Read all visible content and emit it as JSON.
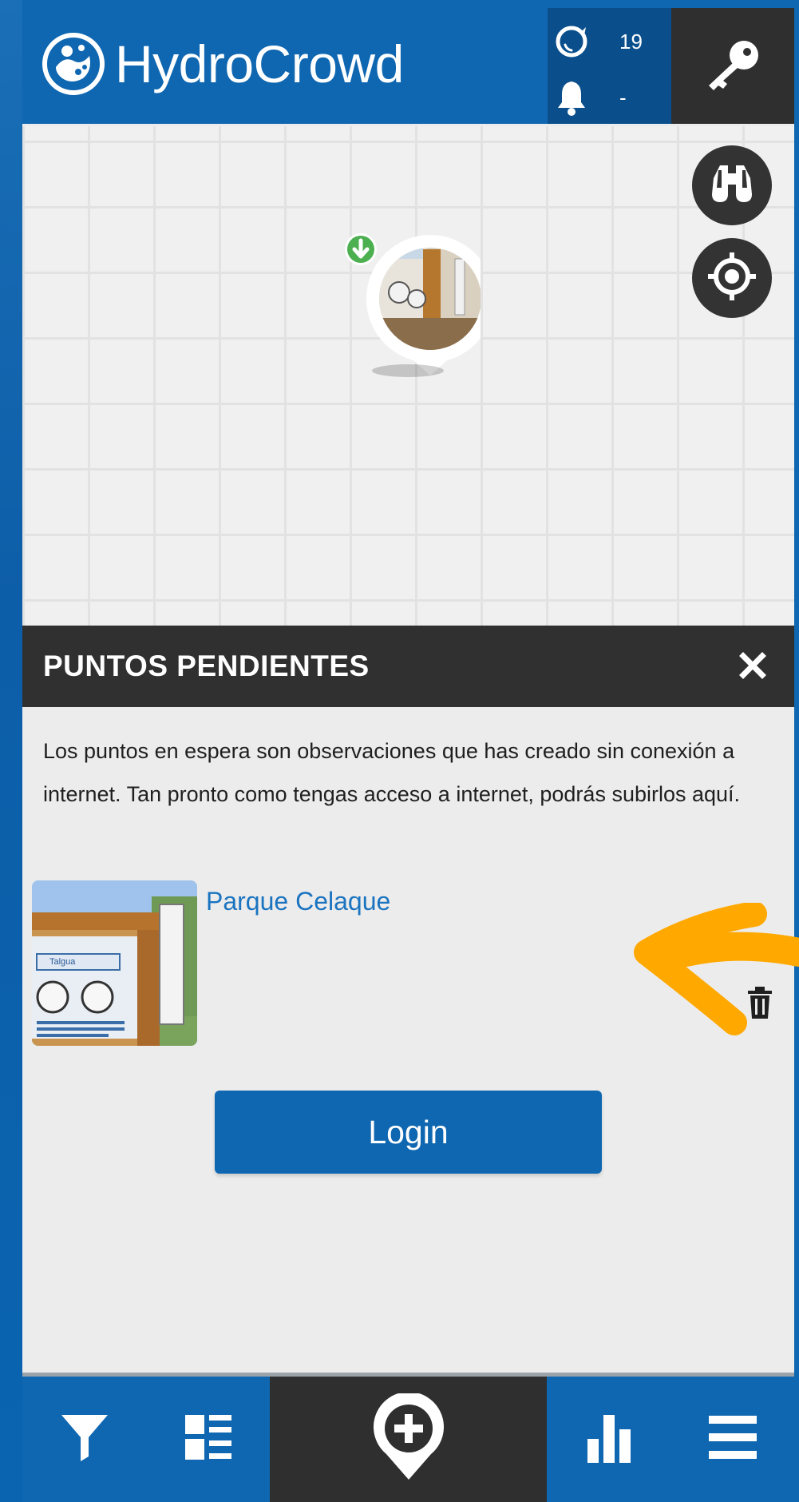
{
  "app": {
    "name": "HydroCrowd"
  },
  "header": {
    "observations_count": "19",
    "notifications_count": "-",
    "icons": {
      "observations": "water-drop-icon",
      "notifications": "bell-icon",
      "login": "key-icon"
    }
  },
  "map": {
    "buttons": {
      "explore": "binoculars-icon",
      "locate": "crosshair-icon"
    },
    "marker_badge_icon": "download-arrow-icon"
  },
  "panel": {
    "title": "PUNTOS PENDIENTES",
    "close_icon": "close-icon",
    "description": "Los puntos en espera son observaciones que has creado sin conexión a internet. Tan pronto como tengas acceso a internet, podrás subirlos aquí.",
    "items": [
      {
        "title": "Parque Celaque",
        "thumbnail_text": "Talgua",
        "delete_icon": "trash-icon"
      }
    ],
    "login_label": "Login"
  },
  "bottom_nav": {
    "items": [
      {
        "icon": "filter-icon"
      },
      {
        "icon": "list-icon"
      },
      {
        "icon": "add-location-icon"
      },
      {
        "icon": "bar-chart-icon"
      },
      {
        "icon": "menu-icon"
      }
    ]
  },
  "colors": {
    "brand_blue": "#0f67b1",
    "dark": "#2f2f2f",
    "link_blue": "#1b74c0",
    "annotation_arrow": "#ffa800",
    "badge_green": "#4caf50"
  }
}
